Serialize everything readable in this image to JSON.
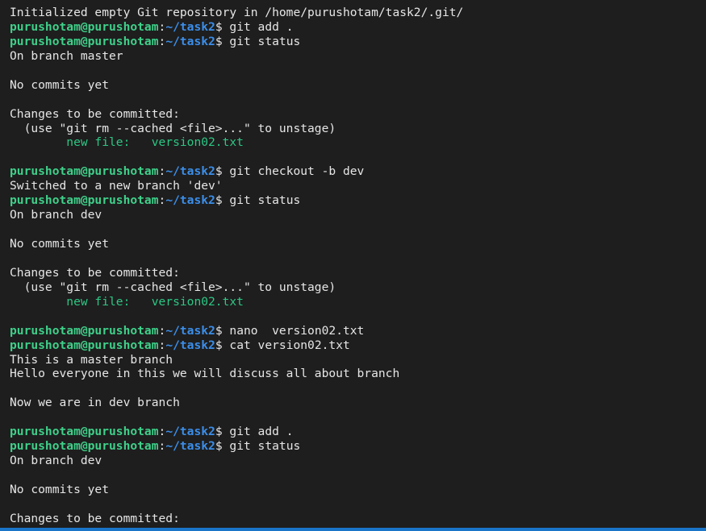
{
  "terminal": {
    "lines": [
      {
        "type": "text",
        "text": "Initialized empty Git repository in /home/purushotam/task2/.git/"
      },
      {
        "type": "prompt",
        "user": "purushotam@purushotam",
        "path": "~/task2",
        "cmd": "git add ."
      },
      {
        "type": "prompt",
        "user": "purushotam@purushotam",
        "path": "~/task2",
        "cmd": "git status"
      },
      {
        "type": "text",
        "text": "On branch master"
      },
      {
        "type": "text",
        "text": ""
      },
      {
        "type": "text",
        "text": "No commits yet"
      },
      {
        "type": "text",
        "text": ""
      },
      {
        "type": "text",
        "text": "Changes to be committed:"
      },
      {
        "type": "text",
        "text": "  (use \"git rm --cached <file>...\" to unstage)"
      },
      {
        "type": "newfile",
        "text": "        new file:   version02.txt"
      },
      {
        "type": "text",
        "text": ""
      },
      {
        "type": "prompt",
        "user": "purushotam@purushotam",
        "path": "~/task2",
        "cmd": "git checkout -b dev"
      },
      {
        "type": "text",
        "text": "Switched to a new branch 'dev'"
      },
      {
        "type": "prompt",
        "user": "purushotam@purushotam",
        "path": "~/task2",
        "cmd": "git status"
      },
      {
        "type": "text",
        "text": "On branch dev"
      },
      {
        "type": "text",
        "text": ""
      },
      {
        "type": "text",
        "text": "No commits yet"
      },
      {
        "type": "text",
        "text": ""
      },
      {
        "type": "text",
        "text": "Changes to be committed:"
      },
      {
        "type": "text",
        "text": "  (use \"git rm --cached <file>...\" to unstage)"
      },
      {
        "type": "newfile",
        "text": "        new file:   version02.txt"
      },
      {
        "type": "text",
        "text": ""
      },
      {
        "type": "prompt",
        "user": "purushotam@purushotam",
        "path": "~/task2",
        "cmd": "nano  version02.txt"
      },
      {
        "type": "prompt",
        "user": "purushotam@purushotam",
        "path": "~/task2",
        "cmd": "cat version02.txt"
      },
      {
        "type": "text",
        "text": "This is a master branch"
      },
      {
        "type": "text",
        "text": "Hello everyone in this we will discuss all about branch"
      },
      {
        "type": "text",
        "text": ""
      },
      {
        "type": "text",
        "text": "Now we are in dev branch"
      },
      {
        "type": "text",
        "text": ""
      },
      {
        "type": "prompt",
        "user": "purushotam@purushotam",
        "path": "~/task2",
        "cmd": "git add ."
      },
      {
        "type": "prompt",
        "user": "purushotam@purushotam",
        "path": "~/task2",
        "cmd": "git status"
      },
      {
        "type": "text",
        "text": "On branch dev"
      },
      {
        "type": "text",
        "text": ""
      },
      {
        "type": "text",
        "text": "No commits yet"
      },
      {
        "type": "text",
        "text": ""
      },
      {
        "type": "text",
        "text": "Changes to be committed:"
      }
    ]
  },
  "colors": {
    "background": "#1e1e1e",
    "text": "#e6e6e6",
    "user": "#3fd08a",
    "path": "#3b8eea",
    "new_file": "#2cc784",
    "status_bar": "#1a75c9"
  }
}
